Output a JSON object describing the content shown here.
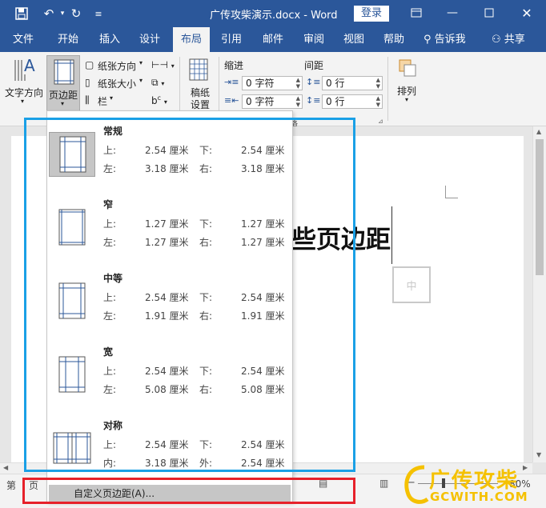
{
  "window": {
    "title": "广传攻柴演示.docx - Word",
    "login_label": "登录"
  },
  "tabs": [
    {
      "label": "文件"
    },
    {
      "label": "开始"
    },
    {
      "label": "插入"
    },
    {
      "label": "设计"
    },
    {
      "label": "布局"
    },
    {
      "label": "引用"
    },
    {
      "label": "邮件"
    },
    {
      "label": "审阅"
    },
    {
      "label": "视图"
    },
    {
      "label": "帮助"
    },
    {
      "label": "告诉我"
    },
    {
      "label": "共享"
    }
  ],
  "ribbon": {
    "text_direction": "文字方向",
    "margins": "页边距",
    "orientation": "纸张方向",
    "size": "纸张大小",
    "columns": "栏",
    "manuscript_line1": "稿纸",
    "manuscript_line2": "设置",
    "indent_label": "缩进",
    "spacing_label": "间距",
    "indent_left": "0 字符",
    "indent_right": "0 字符",
    "spacing_before": "0 行",
    "spacing_after": "0 行",
    "arrange": "排列",
    "group_fragment": "段落"
  },
  "document": {
    "visible_text": "些页边距",
    "box_char": "中"
  },
  "status": {
    "page_fragment": "第",
    "page_fragment2": "页",
    "zoom": "80"
  },
  "margins_menu": {
    "presets": [
      {
        "name": "常规",
        "l1": "上:",
        "v1": "2.54 厘米",
        "l2": "下:",
        "v2": "2.54 厘米",
        "l3": "左:",
        "v3": "3.18 厘米",
        "l4": "右:",
        "v4": "3.18 厘米"
      },
      {
        "name": "窄",
        "l1": "上:",
        "v1": "1.27 厘米",
        "l2": "下:",
        "v2": "1.27 厘米",
        "l3": "左:",
        "v3": "1.27 厘米",
        "l4": "右:",
        "v4": "1.27 厘米"
      },
      {
        "name": "中等",
        "l1": "上:",
        "v1": "2.54 厘米",
        "l2": "下:",
        "v2": "2.54 厘米",
        "l3": "左:",
        "v3": "1.91 厘米",
        "l4": "右:",
        "v4": "1.91 厘米"
      },
      {
        "name": "宽",
        "l1": "上:",
        "v1": "2.54 厘米",
        "l2": "下:",
        "v2": "2.54 厘米",
        "l3": "左:",
        "v3": "5.08 厘米",
        "l4": "右:",
        "v4": "5.08 厘米"
      },
      {
        "name": "对称",
        "l1": "上:",
        "v1": "2.54 厘米",
        "l2": "下:",
        "v2": "2.54 厘米",
        "l3": "内:",
        "v3": "3.18 厘米",
        "l4": "外:",
        "v4": "2.54 厘米"
      }
    ],
    "custom_label": "自定义页边距(A)..."
  },
  "watermark": {
    "text": "广传攻柴",
    "url": "GCWITH.COM"
  },
  "colors": {
    "word_blue": "#2b579a",
    "annotation_blue": "#1aa0e6",
    "annotation_red": "#e6212a",
    "watermark_yellow": "#f5c100"
  }
}
